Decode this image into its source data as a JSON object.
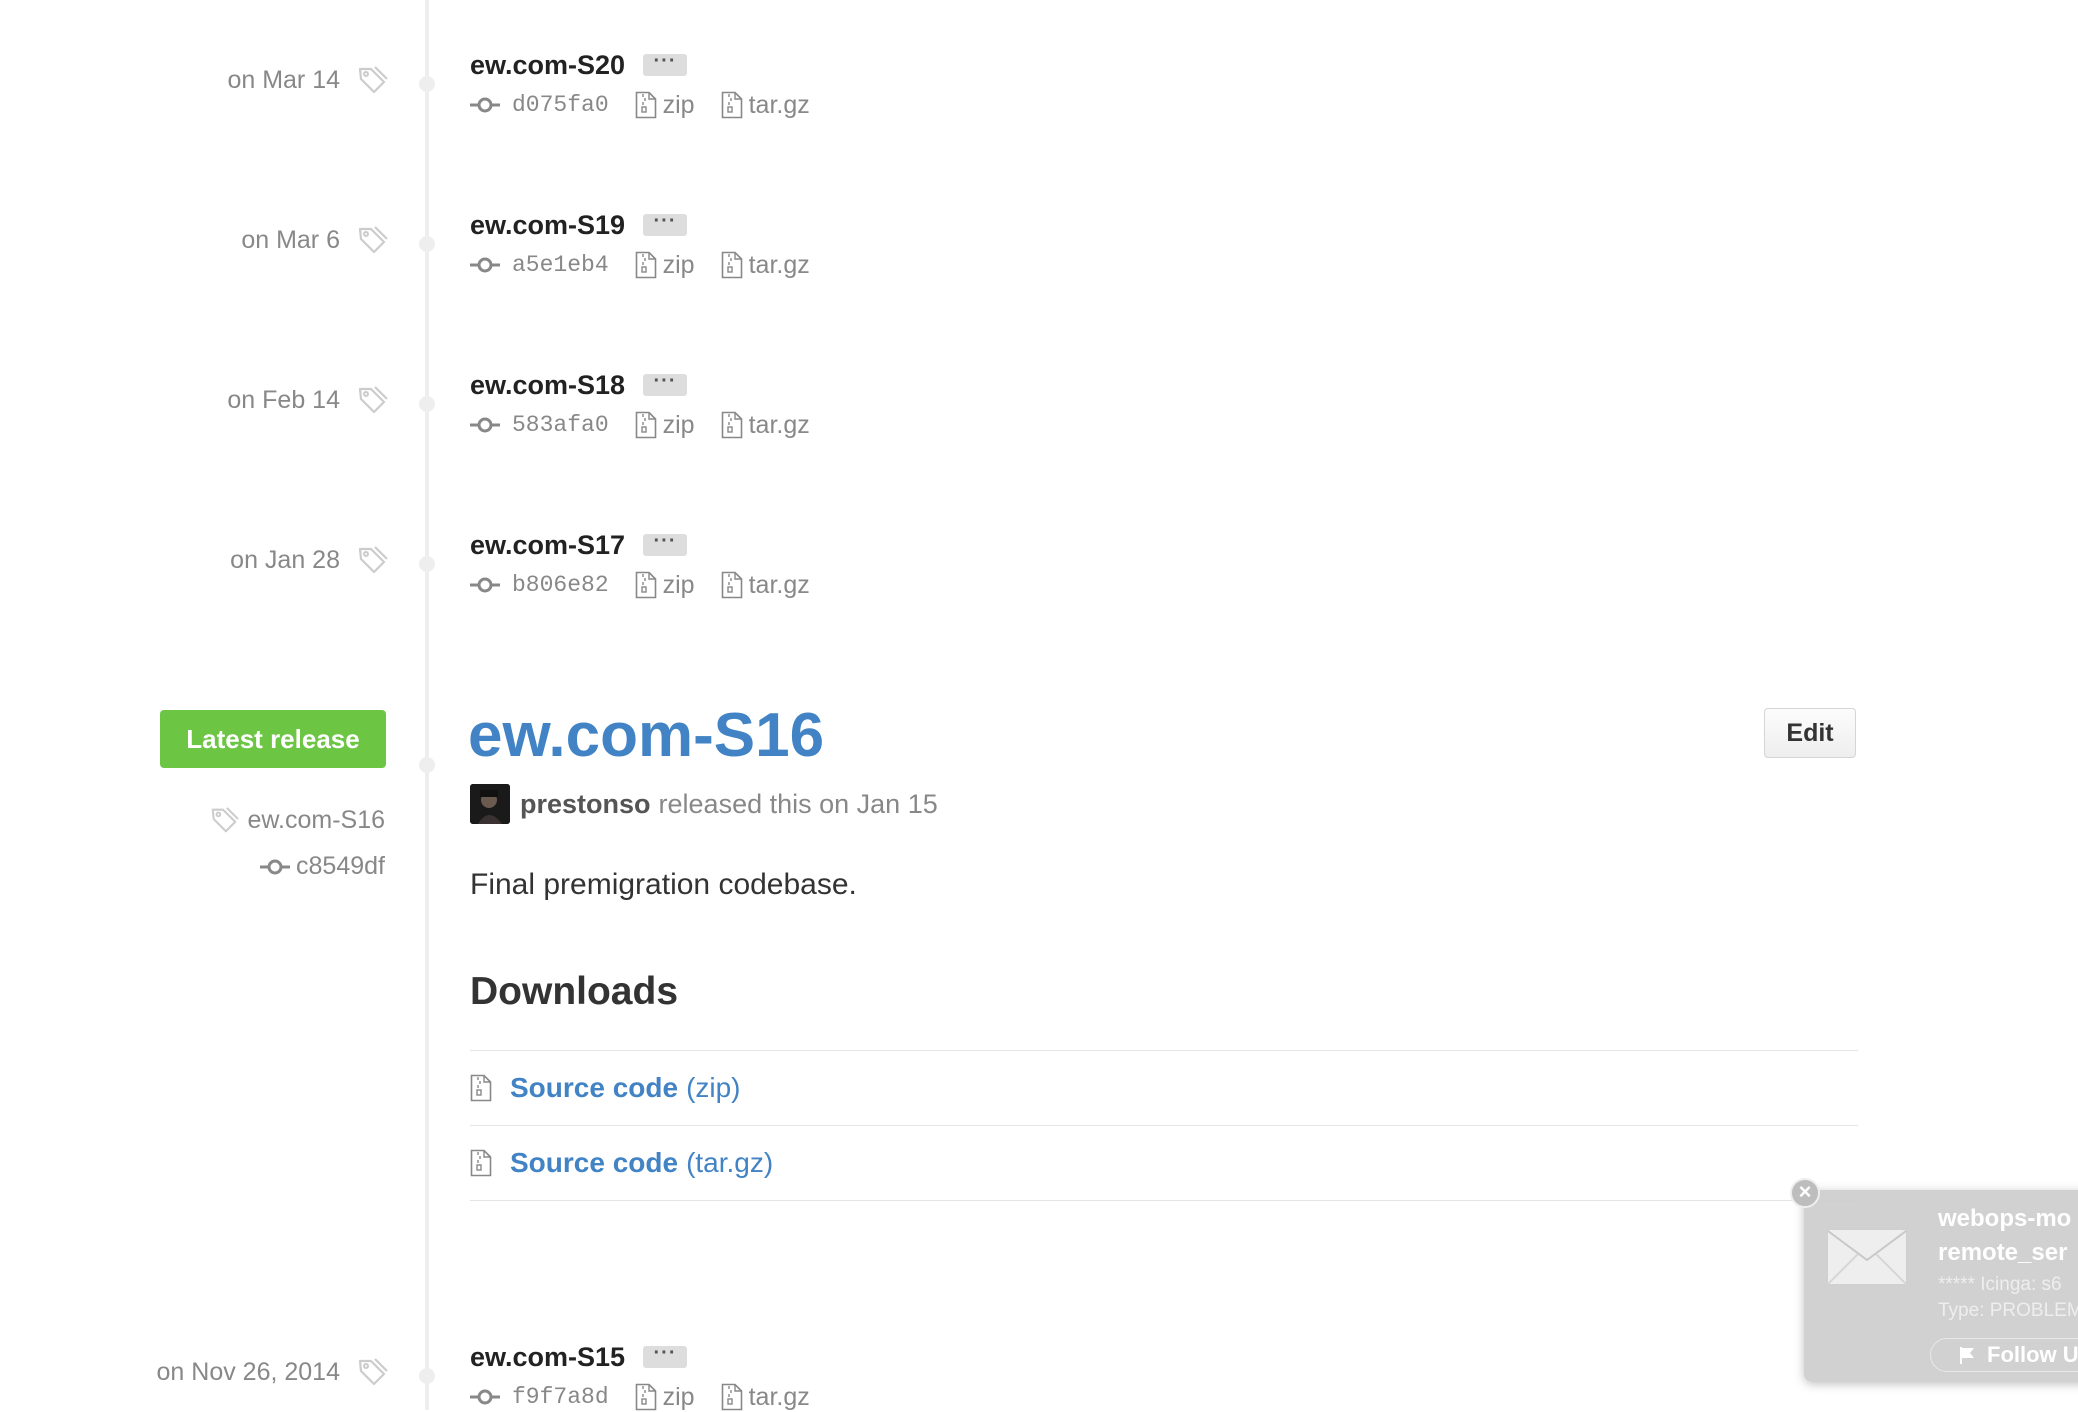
{
  "older_tags": [
    {
      "date": "on Mar 14",
      "name": "ew.com-S20",
      "sha": "d075fa0",
      "zip": "zip",
      "targz": "tar.gz",
      "more": "···"
    },
    {
      "date": "on Mar 6",
      "name": "ew.com-S19",
      "sha": "a5e1eb4",
      "zip": "zip",
      "targz": "tar.gz",
      "more": "···"
    },
    {
      "date": "on Feb 14",
      "name": "ew.com-S18",
      "sha": "583afa0",
      "zip": "zip",
      "targz": "tar.gz",
      "more": "···"
    },
    {
      "date": "on Jan 28",
      "name": "ew.com-S17",
      "sha": "b806e82",
      "zip": "zip",
      "targz": "tar.gz",
      "more": "···"
    }
  ],
  "latest_release": {
    "badge": "Latest release",
    "tag": "ew.com-S16",
    "commit": "c8549df",
    "title": "ew.com-S16",
    "edit_label": "Edit",
    "author": "prestonso",
    "released_text": "released this on Jan 15",
    "body": "Final premigration codebase.",
    "downloads_heading": "Downloads",
    "downloads": [
      {
        "label": "Source code",
        "ext": "(zip)"
      },
      {
        "label": "Source code",
        "ext": "(tar.gz)"
      }
    ]
  },
  "next_tag": {
    "date": "on Nov 26, 2014",
    "name": "ew.com-S15",
    "sha": "f9f7a8d",
    "zip": "zip",
    "targz": "tar.gz",
    "more": "···"
  },
  "notification": {
    "title_line1": "webops-mo",
    "title_line2": "remote_ser",
    "sub_line1": "***** Icinga: s6",
    "sub_line2": "Type: PROBLEM",
    "follow_label": "Follow U",
    "close": "×"
  },
  "colors": {
    "accent": "#4183c4",
    "latest_badge": "#6cc644",
    "muted": "#888888"
  }
}
